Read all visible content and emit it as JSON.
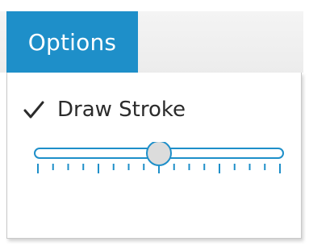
{
  "menu": {
    "tab_label": "Options"
  },
  "panel": {
    "draw_stroke": {
      "label": "Draw Stroke",
      "checked": true
    },
    "stroke_slider": {
      "value_fraction": 0.5,
      "tick_count": 17
    }
  },
  "colors": {
    "accent": "#1e8fc9",
    "menubar": "#efefef",
    "slider_track": "#1e8fc9",
    "slider_thumb": "#dcdcdc",
    "text": "#2b2b2b"
  },
  "icons": {
    "check": "checkmark-icon"
  }
}
